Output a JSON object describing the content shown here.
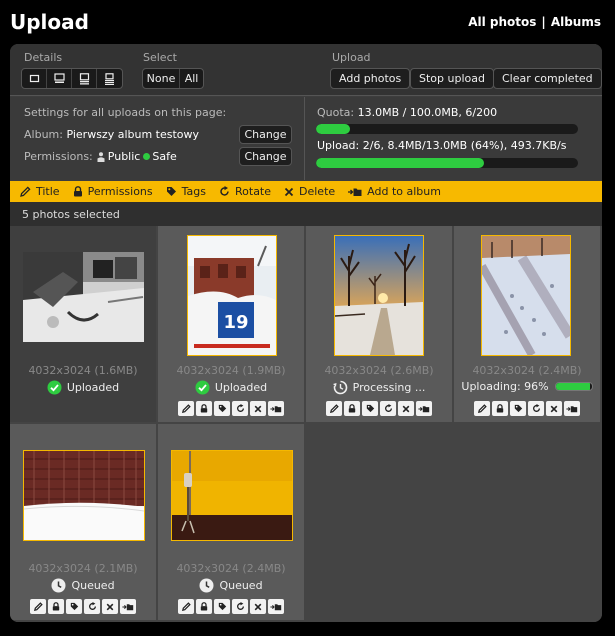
{
  "header": {
    "title": "Upload",
    "nav": [
      {
        "label": "All photos"
      },
      {
        "label": "Albums"
      }
    ],
    "nav_separator": "|"
  },
  "toolbar": {
    "details_label": "Details",
    "select_label": "Select",
    "select_none": "None",
    "select_all": "All",
    "upload_label": "Upload",
    "add_photos": "Add photos",
    "stop_upload": "Stop upload",
    "clear_completed": "Clear completed"
  },
  "settings": {
    "heading": "Settings for all uploads on this page:",
    "album_label": "Album:",
    "album_value": "Pierwszy album testowy",
    "permissions_label": "Permissions:",
    "perm_public": "Public",
    "perm_safe": "Safe",
    "change": "Change"
  },
  "quota": {
    "label": "Quota:",
    "value": "13.0MB / 100.0MB, 6/200",
    "fraction": 0.13
  },
  "upload": {
    "label": "Upload:",
    "value": "2/6, 8.4MB/13.0MB (64%), 493.7KB/s",
    "fraction": 0.64
  },
  "actions_bar": {
    "title": "Title",
    "permissions": "Permissions",
    "tags": "Tags",
    "rotate": "Rotate",
    "delete": "Delete",
    "add_to_album": "Add to album"
  },
  "selection": {
    "text": "5 photos selected"
  },
  "photos": [
    {
      "meta": "4032x3024 (1.6MB)",
      "status": "Uploaded"
    },
    {
      "meta": "4032x3024 (1.9MB)",
      "status": "Uploaded"
    },
    {
      "meta": "4032x3024 (2.6MB)",
      "status": "Processing ..."
    },
    {
      "meta": "4032x3024 (2.4MB)",
      "status": "Uploading: 96%",
      "progress": 0.96
    },
    {
      "meta": "4032x3024 (2.1MB)",
      "status": "Queued"
    },
    {
      "meta": "4032x3024 (2.4MB)",
      "status": "Queued"
    }
  ],
  "colors": {
    "accent": "#f7b900",
    "progress": "#2ecc40",
    "panel": "#3d3d3d"
  }
}
